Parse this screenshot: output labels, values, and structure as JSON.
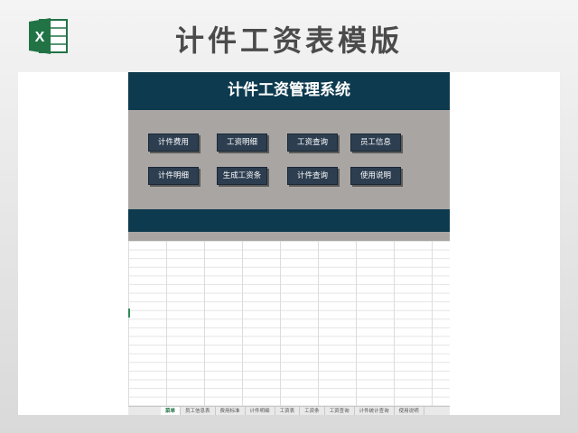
{
  "page_title": "计件工资表模版",
  "logo": {
    "icon": "excel-icon",
    "letter": "X",
    "color": "#217346"
  },
  "system": {
    "title": "计件工资管理系统",
    "buttons": [
      {
        "label": "计件费用"
      },
      {
        "label": "工资明细"
      },
      {
        "label": "工资查询"
      },
      {
        "label": "员工信息"
      },
      {
        "label": "计件明细"
      },
      {
        "label": "生成工资条"
      },
      {
        "label": "计件查询"
      },
      {
        "label": "使用说明"
      }
    ]
  },
  "sheet_tabs": [
    {
      "label": "菜单",
      "active": true
    },
    {
      "label": "员工信息表"
    },
    {
      "label": "费用标准"
    },
    {
      "label": "计件明细"
    },
    {
      "label": "工资表"
    },
    {
      "label": "工资条"
    },
    {
      "label": "工资查询"
    },
    {
      "label": "计件统计查询"
    },
    {
      "label": "使用说明"
    }
  ],
  "colors": {
    "header_bg": "#0d3a4f",
    "panel_bg": "#a8a5a3",
    "button_bg": "#2d3e50",
    "active_tab": "#217346"
  }
}
